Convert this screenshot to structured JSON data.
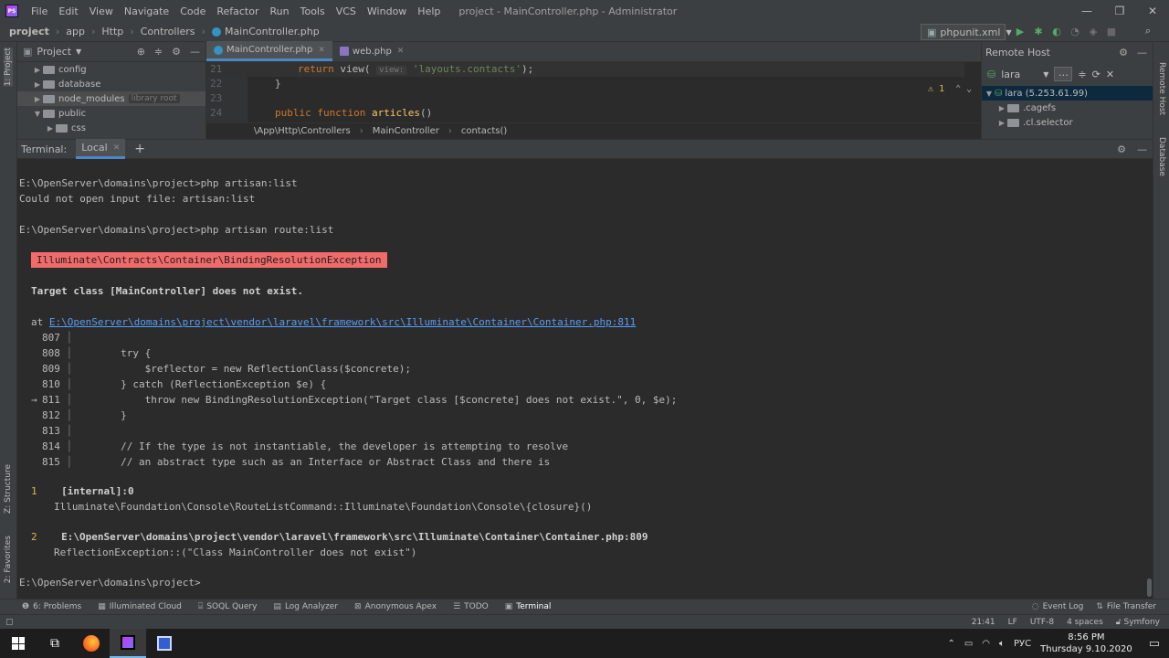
{
  "app": {
    "menu": [
      "File",
      "Edit",
      "View",
      "Navigate",
      "Code",
      "Refactor",
      "Run",
      "Tools",
      "VCS",
      "Window",
      "Help"
    ],
    "window_title": "project - MainController.php - Administrator"
  },
  "nav": {
    "crumbs": [
      "project",
      "app",
      "Http",
      "Controllers",
      "MainController.php"
    ],
    "run_config": "phpunit.xml"
  },
  "left_strip": {
    "project": "1: Project",
    "structure": "Z: Structure",
    "favorites": "2: Favorites"
  },
  "right_strip": {
    "remote": "Remote Host",
    "database": "Database"
  },
  "project_panel": {
    "title": "Project",
    "items": [
      {
        "label": "config",
        "hint": ""
      },
      {
        "label": "database",
        "hint": ""
      },
      {
        "label": "node_modules",
        "hint": "library root"
      },
      {
        "label": "public",
        "hint": ""
      },
      {
        "label": "css",
        "hint": ""
      }
    ]
  },
  "editor": {
    "tabs": [
      {
        "label": "MainController.php"
      },
      {
        "label": "web.php"
      }
    ],
    "lines": [
      {
        "num": "21"
      },
      {
        "num": "22"
      },
      {
        "num": "23"
      },
      {
        "num": "24"
      }
    ],
    "code": {
      "return_kw": "return ",
      "view_fn": "view(",
      "param_hint": "view:",
      "view_arg": "'layouts.contacts'",
      "end": ");",
      "brace": "}",
      "public_kw": "public function ",
      "articles_fn": "articles",
      "parens": "()"
    },
    "warning_count": "1",
    "breadcrumb": [
      "\\App\\Http\\Controllers",
      "MainController",
      "contacts()"
    ]
  },
  "remote_host": {
    "title": "Remote Host",
    "server": "lara",
    "tree": [
      {
        "label": "lara (5.253.61.99)"
      },
      {
        "label": ".cagefs"
      },
      {
        "label": ".cl.selector"
      }
    ]
  },
  "terminal": {
    "label": "Terminal:",
    "tab": "Local",
    "lines": {
      "l1": "E:\\OpenServer\\domains\\project>php artisan:list",
      "l2": "Could not open input file: artisan:list",
      "l3": "E:\\OpenServer\\domains\\project>php artisan route:list",
      "exception": "Illuminate\\Contracts\\Container\\BindingResolutionException",
      "message": "Target class [MainController] does not exist.",
      "at": "at ",
      "at_link": "E:\\OpenServer\\domains\\project\\vendor\\laravel\\framework\\src\\Illuminate\\Container\\Container.php:811",
      "prompt": "E:\\OpenServer\\domains\\project>"
    },
    "snippet": [
      {
        "marker": "",
        "num": "807",
        "code": ""
      },
      {
        "marker": "",
        "num": "808",
        "code": "        try {"
      },
      {
        "marker": "",
        "num": "809",
        "code": "            $reflector = new ReflectionClass($concrete);"
      },
      {
        "marker": "",
        "num": "810",
        "code": "        } catch (ReflectionException $e) {"
      },
      {
        "marker": "→",
        "num": "811",
        "code": "            throw new BindingResolutionException(\"Target class [$concrete] does not exist.\", 0, $e);"
      },
      {
        "marker": "",
        "num": "812",
        "code": "        }"
      },
      {
        "marker": "",
        "num": "813",
        "code": ""
      },
      {
        "marker": "",
        "num": "814",
        "code": "        // If the type is not instantiable, the developer is attempting to resolve"
      },
      {
        "marker": "",
        "num": "815",
        "code": "        // an abstract type such as an Interface or Abstract Class and there is"
      }
    ],
    "trace": [
      {
        "idx": "1",
        "loc": "[internal]:0",
        "call": "Illuminate\\Foundation\\Console\\RouteListCommand::Illuminate\\Foundation\\Console\\{closure}()"
      },
      {
        "idx": "2",
        "loc": "E:\\OpenServer\\domains\\project\\vendor\\laravel\\framework\\src\\Illuminate\\Container\\Container.php:809",
        "call": "ReflectionException::(\"Class MainController does not exist\")"
      }
    ]
  },
  "tool_tabs": {
    "left": [
      "6: Problems",
      "Illuminated Cloud",
      "SOQL Query",
      "Log Analyzer",
      "Anonymous Apex",
      "TODO",
      "Terminal"
    ],
    "right": [
      "Event Log",
      "File Transfer"
    ]
  },
  "status": {
    "position": "21:41",
    "line_sep": "LF",
    "encoding": "UTF-8",
    "indent": "4 spaces",
    "framework": "Symfony"
  },
  "taskbar": {
    "lang": "РУС",
    "time": "8:56 PM",
    "date": "Thursday 9.10.2020"
  },
  "colors": {
    "exception_bg": "#f26b6b",
    "link": "#589df6",
    "accent_tab": "#4a88c7"
  }
}
